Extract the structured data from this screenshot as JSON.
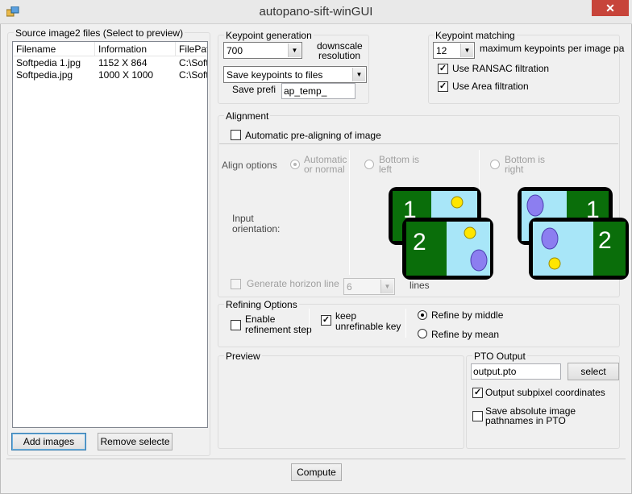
{
  "window": {
    "title": "autopano-sift-winGUI",
    "close_glyph": "✕"
  },
  "source": {
    "group_label": "Source image2  files (Select to preview)",
    "columns": [
      "Filename",
      "Information",
      "FilePath"
    ],
    "rows": [
      {
        "filename": "Softpedia 1.jpg",
        "info": "1152 X 864",
        "path": "C:\\Soft"
      },
      {
        "filename": "Softpedia.jpg",
        "info": "1000 X 1000",
        "path": "C:\\Soft"
      }
    ],
    "add_button": "Add images",
    "remove_button": "Remove selecte"
  },
  "keypoint_generation": {
    "group_label": "Keypoint generation",
    "resolution_value": "700",
    "resolution_label_1": "downscale",
    "resolution_label_2": "resolution",
    "save_option": "Save keypoints to files",
    "prefix_label": "Save prefi",
    "prefix_value": "ap_temp_"
  },
  "keypoint_matching": {
    "group_label": "Keypoint matching",
    "max_value": "12",
    "max_label": "maximum keypoints per image pa",
    "ransac_label": "Use RANSAC filtration",
    "ransac_checked": true,
    "area_label": "Use Area filtration",
    "area_checked": true
  },
  "alignment": {
    "group_label": "Alignment",
    "auto_prealign_label": "Automatic pre-aligning of image",
    "align_options_label": "Align options",
    "option_auto": [
      "Automatic",
      "or normal"
    ],
    "option_bottom_left": [
      "Bottom is",
      "left"
    ],
    "option_bottom_right": [
      "Bottom is",
      "right"
    ],
    "input_orientation": [
      "Input",
      "orientation:"
    ],
    "horizon_label": "Generate horizon line",
    "horizon_value": "6",
    "lines_label": "lines",
    "panel_numbers": [
      "1",
      "2",
      "1",
      "2"
    ]
  },
  "refining": {
    "group_label": "Refining Options",
    "enable_label": [
      "Enable",
      "refinement step"
    ],
    "keep_label": [
      "keep",
      "unrefinable key"
    ],
    "keep_checked": true,
    "by_middle": "Refine by middle",
    "by_mean": "Refine by mean"
  },
  "preview": {
    "group_label": "Preview"
  },
  "pto": {
    "group_label": "PTO Output",
    "file_value": "output.pto",
    "select_button": "select",
    "subpixel_label": "Output subpixel coordinates",
    "subpixel_checked": true,
    "absolute_label": [
      "Save absolute image",
      "pathnames in PTO"
    ]
  },
  "compute_button": "Compute",
  "colors": {
    "panel_green": "#0a6e0a",
    "sky": "#a8e6f8",
    "close_red": "#c7443a"
  }
}
